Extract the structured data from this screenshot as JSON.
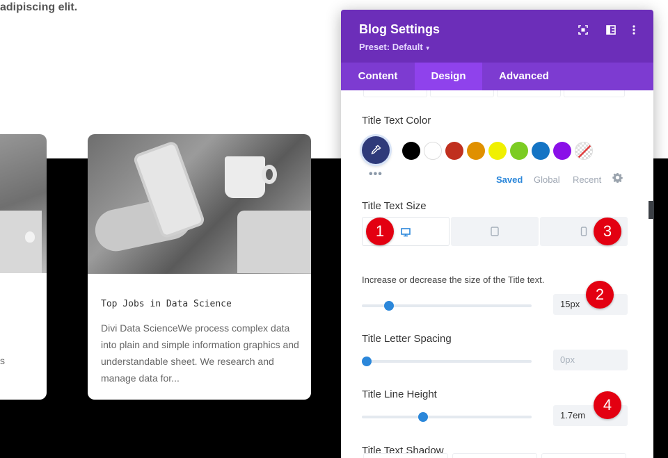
{
  "page": {
    "intro_text": "adipiscing elit.",
    "left_card_excerpt_fragment": "s",
    "card": {
      "title": "Top Jobs in Data Science",
      "excerpt": "Divi Data ScienceWe process complex data into plain and simple information graphics and understandable sheet. We research and manage data for..."
    }
  },
  "panel": {
    "title": "Blog Settings",
    "preset": "Preset: Default",
    "header_icons": [
      "fullscreen-icon",
      "split-view-icon",
      "more-options-icon"
    ],
    "tabs": [
      {
        "label": "Content",
        "active": false
      },
      {
        "label": "Design",
        "active": true
      },
      {
        "label": "Advanced",
        "active": false
      }
    ],
    "title_text_color": {
      "label": "Title Text Color",
      "active_color": "#2e3a7a",
      "swatches": [
        "#000000",
        "#ffffff",
        "#c0301f",
        "#e09000",
        "#f0f000",
        "#7ccc22",
        "#1474c4",
        "#8a10e8",
        "none"
      ],
      "more": "•••",
      "palette_tabs": [
        "Saved",
        "Global",
        "Recent"
      ]
    },
    "title_text_size": {
      "label": "Title Text Size",
      "devices": [
        "desktop-icon",
        "tablet-icon",
        "phone-icon"
      ],
      "helper": "Increase or decrease the size of the Title text.",
      "value": "15px",
      "slider_fraction": 0.16
    },
    "title_letter_spacing": {
      "label": "Title Letter Spacing",
      "value": "0px",
      "slider_fraction": 0.03
    },
    "title_line_height": {
      "label": "Title Line Height",
      "value": "1.7em",
      "slider_fraction": 0.36
    },
    "title_text_shadow": {
      "label": "Title Text Shadow"
    }
  },
  "badges": [
    "1",
    "2",
    "3",
    "4"
  ],
  "colors": {
    "header": "#6c2eb9",
    "tabs": "#7d3bd1",
    "active_tab": "#8f42ec",
    "accent": "#2b87da",
    "badge": "#e30011"
  }
}
